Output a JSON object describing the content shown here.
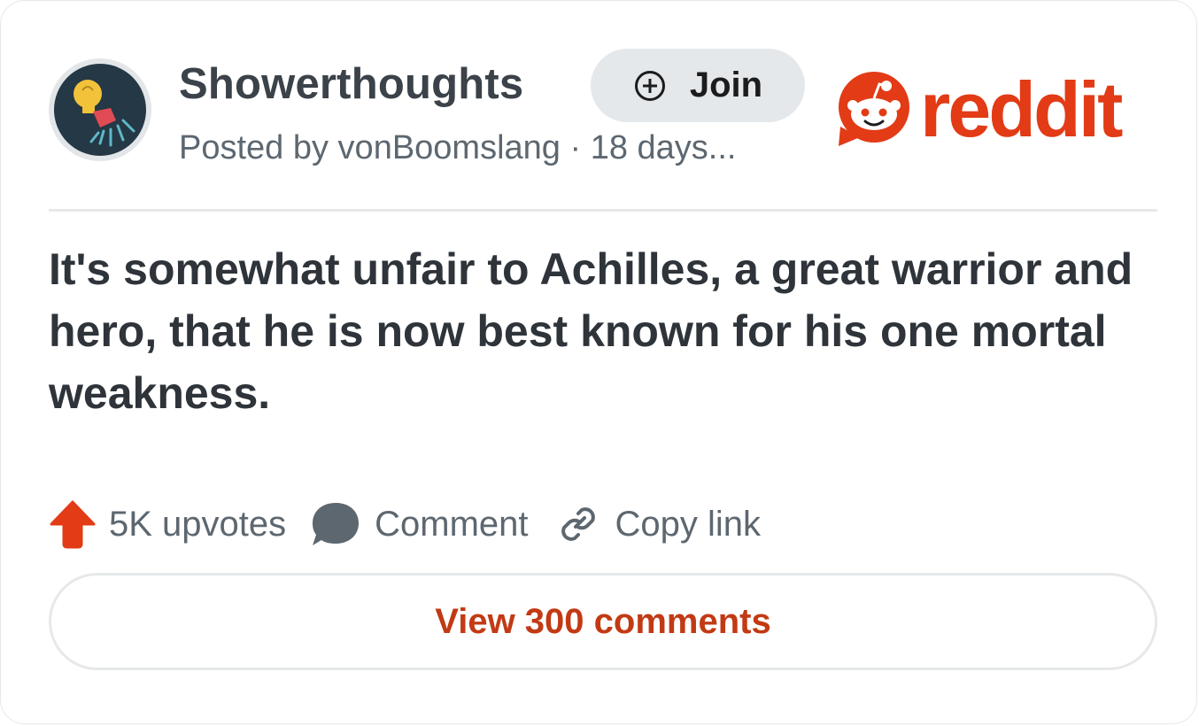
{
  "post": {
    "subreddit": "Showerthoughts",
    "join_label": "Join",
    "posted_by": "Posted by vonBoomslang · 18 days...",
    "title": "It's somewhat unfair to Achilles, a great warrior and hero, that he is now best known for his one mortal weakness."
  },
  "brand": {
    "wordmark": "reddit",
    "accent_color": "#e23b16"
  },
  "actions": {
    "upvotes": "5K upvotes",
    "comment": "Comment",
    "copy_link": "Copy link"
  },
  "footer": {
    "view_comments": "View 300 comments"
  },
  "icons": {
    "avatar": "showerhead-lightbulb-icon",
    "join": "plus-circle-icon",
    "upvote": "upvote-arrow-icon",
    "comment": "speech-bubble-icon",
    "copy_link": "chain-link-icon",
    "logo": "reddit-snoo-icon"
  },
  "colors": {
    "text_primary": "#2e343a",
    "text_secondary": "#5d6770",
    "upvote": "#e23b16",
    "view_comments": "#c23a14"
  }
}
